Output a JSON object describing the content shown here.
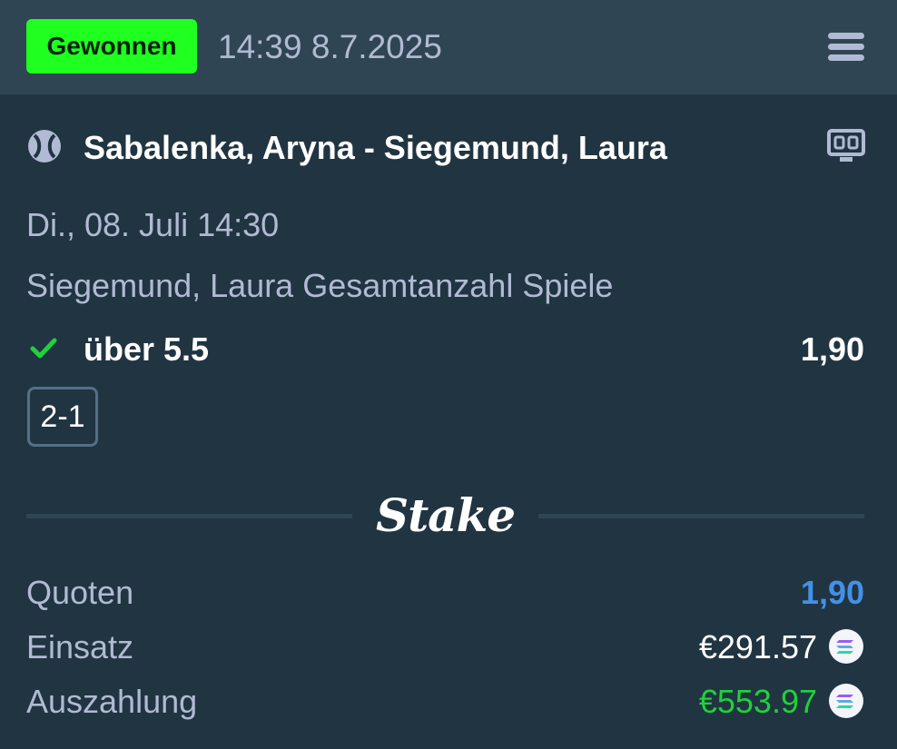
{
  "header": {
    "status_badge": "Gewonnen",
    "timestamp": "14:39 8.7.2025",
    "menu_icon": "menu-icon",
    "colors": {
      "badge_bg": "#1fff20",
      "header_bg": "#2f4553"
    }
  },
  "event": {
    "sport_icon": "tennis-ball-icon",
    "title": "Sabalenka, Aryna - Siegemund, Laura",
    "live_icon": "scoreboard-icon",
    "date": "Di., 08. Juli 14:30",
    "market": "Siegemund, Laura Gesamtanzahl Spiele",
    "selection": "über 5.5",
    "selection_odds": "1,90",
    "result_icon": "check-icon",
    "score": "2-1"
  },
  "brand": {
    "logo_text": "Stake"
  },
  "summary": {
    "odds_label": "Quoten",
    "odds_value": "1,90",
    "stake_label": "Einsatz",
    "stake_value": "€291.57",
    "payout_label": "Auszahlung",
    "payout_value": "€553.97",
    "currency_icon": "solana-coin-icon",
    "colors": {
      "odds": "#4391e7",
      "payout": "#1fd13a",
      "stake": "#ffffff"
    }
  }
}
